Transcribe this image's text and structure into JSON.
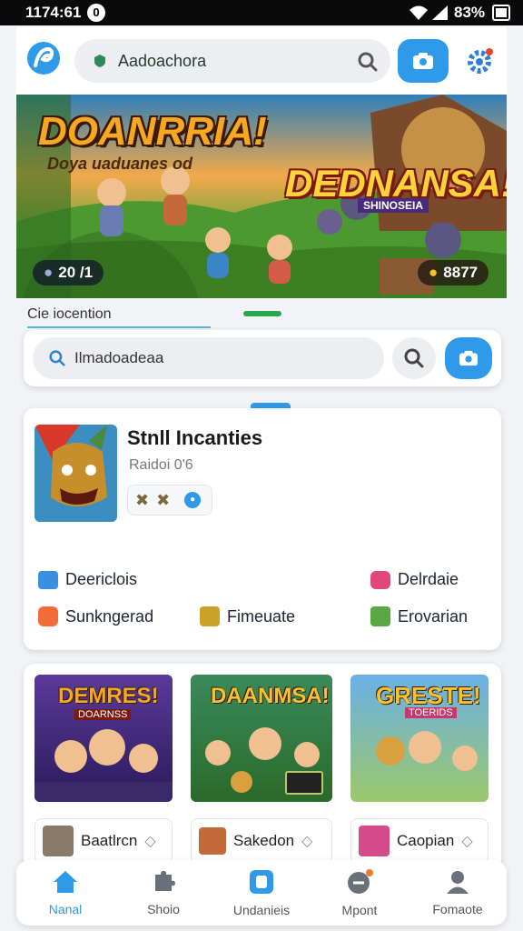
{
  "status": {
    "time": "1174:61",
    "notif": "0",
    "battery": "83%"
  },
  "search_top": {
    "text": "Aadoachora"
  },
  "banner": {
    "title_left": "DOANRRIA!",
    "subtitle_left": "Doya uaduanes od",
    "title_right": "DEDNANSA!",
    "subtitle_right": "SHINOSEIA",
    "badge_left": "20 /1",
    "badge_right": "8877"
  },
  "section": {
    "label": "Cie iocention"
  },
  "search_second": {
    "text": "Ilmadoadeaa"
  },
  "app": {
    "name": "Stnll Incanties",
    "developer": "Raidoi 0'6"
  },
  "links": [
    {
      "label": "Deericlois",
      "color": "#3b8fe0"
    },
    {
      "label": "Delrdaie",
      "color": "#e0457b"
    },
    {
      "label": "Sunkngerad",
      "color": "#f26b3a"
    },
    {
      "label": "Fimeuate",
      "color": "#c9a227"
    },
    {
      "label": "Erovarian",
      "color": "#5aa843"
    }
  ],
  "games": [
    {
      "title": "DEMRES!",
      "sub": "DOARNSS",
      "name": "Baatlrcn"
    },
    {
      "title": "DAANMSA!",
      "sub": "",
      "name": "Sakedon"
    },
    {
      "title": "GRESTE!",
      "sub": "TOERIDS",
      "name": "Caopian"
    }
  ],
  "nav": [
    {
      "label": "Nanal",
      "active": true
    },
    {
      "label": "Shoio",
      "active": false
    },
    {
      "label": "Undanieis",
      "active": false
    },
    {
      "label": "Mpont",
      "active": false
    },
    {
      "label": "Fomaote",
      "active": false
    }
  ]
}
